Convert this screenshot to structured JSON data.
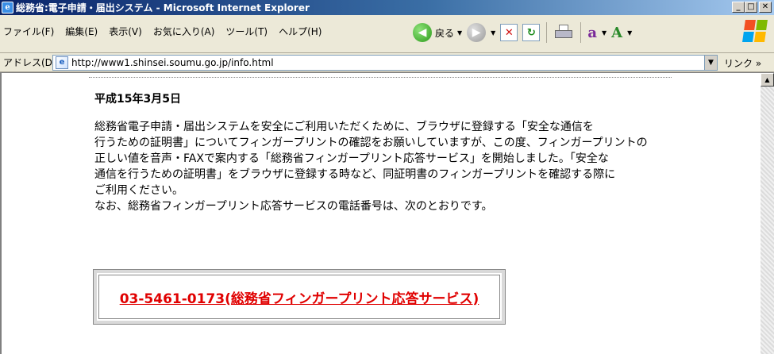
{
  "window": {
    "title": "総務省:電子申請・届出システム - Microsoft Internet Explorer",
    "minimize": "_",
    "maximize": "□",
    "close": "✕"
  },
  "menu": {
    "items": [
      {
        "label": "ファイル(F)"
      },
      {
        "label": "編集(E)"
      },
      {
        "label": "表示(V)"
      },
      {
        "label": "お気に入り(A)"
      },
      {
        "label": "ツール(T)"
      },
      {
        "label": "ヘルプ(H)"
      }
    ]
  },
  "toolbar": {
    "back_label": "戻る"
  },
  "address": {
    "label": "アドレス(D)",
    "url": "http://www1.shinsei.soumu.go.jp/info.html",
    "links_label": "リンク »"
  },
  "page": {
    "date": "平成15年3月5日",
    "paragraph_lines": [
      "総務省電子申請・届出システムを安全にご利用いただくために、ブラウザに登録する「安全な通信を",
      "行うための証明書」についてフィンガープリントの確認をお願いしていますが、この度、フィンガープリントの",
      "正しい値を音声・FAXで案内する「総務省フィンガープリント応答サービス」を開始しました。「安全な",
      "通信を行うための証明書」をブラウザに登録する時など、同証明書のフィンガープリントを確認する際に",
      "ご利用ください。",
      "なお、総務省フィンガープリント応答サービスの電話番号は、次のとおりです。"
    ],
    "phone_link": "03-5461-0173(総務省フィンガープリント応答サービス)"
  },
  "colors": {
    "link": "#e00000",
    "titlebar": "#0a246a"
  }
}
